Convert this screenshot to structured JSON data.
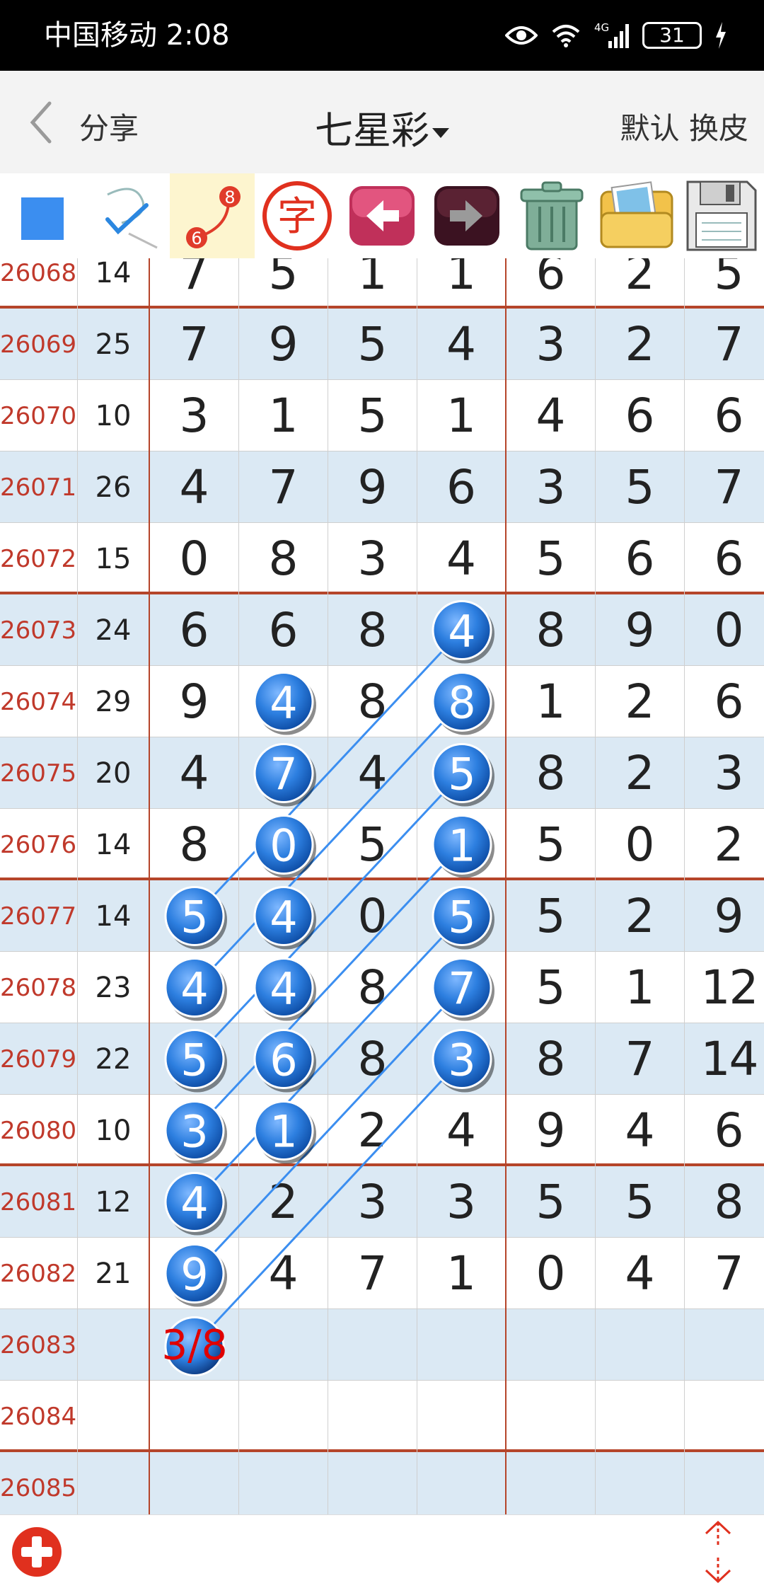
{
  "status_bar": {
    "carrier_time": "中国移动 2:08",
    "signal_label": "4G",
    "battery": "31"
  },
  "nav": {
    "share_label": "分享",
    "title": "七星彩",
    "right_labels": "默认 换皮"
  },
  "toolbar": {
    "tools": [
      "color-square-icon",
      "check-pen-icon",
      "line-connect-icon",
      "char-icon",
      "arrow-left-icon",
      "arrow-right-icon",
      "trash-icon",
      "gallery-icon",
      "save-icon"
    ],
    "connect_badge_top": "8",
    "connect_badge_bottom": "6",
    "char_label": "字",
    "accent": "#3b8ef0"
  },
  "grid": {
    "rows": [
      {
        "issue": "26068",
        "sum": "14",
        "nums": [
          "7",
          "5",
          "1",
          "1",
          "6",
          "2",
          "5"
        ]
      },
      {
        "issue": "26069",
        "sum": "25",
        "nums": [
          "7",
          "9",
          "5",
          "4",
          "3",
          "2",
          "7"
        ]
      },
      {
        "issue": "26070",
        "sum": "10",
        "nums": [
          "3",
          "1",
          "5",
          "1",
          "4",
          "6",
          "6"
        ]
      },
      {
        "issue": "26071",
        "sum": "26",
        "nums": [
          "4",
          "7",
          "9",
          "6",
          "3",
          "5",
          "7"
        ]
      },
      {
        "issue": "26072",
        "sum": "15",
        "nums": [
          "0",
          "8",
          "3",
          "4",
          "5",
          "6",
          "6"
        ]
      },
      {
        "issue": "26073",
        "sum": "24",
        "nums": [
          "6",
          "6",
          "8",
          "4",
          "8",
          "9",
          "0"
        ]
      },
      {
        "issue": "26074",
        "sum": "29",
        "nums": [
          "9",
          "4",
          "8",
          "8",
          "1",
          "2",
          "6"
        ]
      },
      {
        "issue": "26075",
        "sum": "20",
        "nums": [
          "4",
          "7",
          "4",
          "5",
          "8",
          "2",
          "3"
        ]
      },
      {
        "issue": "26076",
        "sum": "14",
        "nums": [
          "8",
          "0",
          "5",
          "1",
          "5",
          "0",
          "2"
        ]
      },
      {
        "issue": "26077",
        "sum": "14",
        "nums": [
          "5",
          "4",
          "0",
          "5",
          "5",
          "2",
          "9"
        ]
      },
      {
        "issue": "26078",
        "sum": "23",
        "nums": [
          "4",
          "4",
          "8",
          "7",
          "5",
          "1",
          "12"
        ]
      },
      {
        "issue": "26079",
        "sum": "22",
        "nums": [
          "5",
          "6",
          "8",
          "3",
          "8",
          "7",
          "14"
        ]
      },
      {
        "issue": "26080",
        "sum": "10",
        "nums": [
          "3",
          "1",
          "2",
          "4",
          "9",
          "4",
          "6"
        ]
      },
      {
        "issue": "26081",
        "sum": "12",
        "nums": [
          "4",
          "2",
          "3",
          "3",
          "5",
          "5",
          "8"
        ]
      },
      {
        "issue": "26082",
        "sum": "21",
        "nums": [
          "9",
          "4",
          "7",
          "1",
          "0",
          "4",
          "7"
        ]
      },
      {
        "issue": "26083",
        "sum": "",
        "nums": [
          "",
          "",
          "",
          "",
          "",
          "",
          ""
        ]
      },
      {
        "issue": "26084",
        "sum": "",
        "nums": [
          "",
          "",
          "",
          "",
          "",
          "",
          ""
        ]
      },
      {
        "issue": "26085",
        "sum": "",
        "nums": [
          "",
          "",
          "",
          "",
          "",
          "",
          ""
        ]
      }
    ],
    "sep_after_rows": [
      0,
      4,
      8,
      12,
      16
    ],
    "highlight": [
      {
        "row": 5,
        "col": 3
      },
      {
        "row": 6,
        "col": 3
      },
      {
        "row": 7,
        "col": 3
      },
      {
        "row": 8,
        "col": 3
      },
      {
        "row": 9,
        "col": 3
      },
      {
        "row": 10,
        "col": 3
      },
      {
        "row": 11,
        "col": 3
      },
      {
        "row": 6,
        "col": 1
      },
      {
        "row": 7,
        "col": 1
      },
      {
        "row": 8,
        "col": 1
      },
      {
        "row": 9,
        "col": 1
      },
      {
        "row": 10,
        "col": 1
      },
      {
        "row": 11,
        "col": 1
      },
      {
        "row": 12,
        "col": 1
      },
      {
        "row": 9,
        "col": 0
      },
      {
        "row": 10,
        "col": 0
      },
      {
        "row": 11,
        "col": 0
      },
      {
        "row": 12,
        "col": 0
      },
      {
        "row": 13,
        "col": 0
      },
      {
        "row": 14,
        "col": 0
      }
    ],
    "lines": [
      [
        [
          5,
          3
        ],
        [
          9,
          0
        ]
      ],
      [
        [
          6,
          3
        ],
        [
          10,
          0
        ]
      ],
      [
        [
          7,
          3
        ],
        [
          11,
          0
        ]
      ],
      [
        [
          8,
          3
        ],
        [
          12,
          0
        ]
      ],
      [
        [
          9,
          3
        ],
        [
          13,
          0
        ]
      ],
      [
        [
          10,
          3
        ],
        [
          14,
          0
        ]
      ],
      [
        [
          11,
          3
        ],
        [
          15,
          0
        ]
      ]
    ],
    "prediction": {
      "row": 15,
      "col": 0,
      "label": "3/8"
    },
    "ball_color": "#2d7fe0",
    "line_color": "#3b8ef0",
    "prediction_color": "#e00000"
  }
}
